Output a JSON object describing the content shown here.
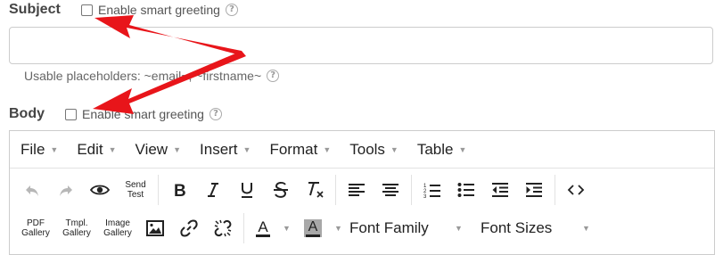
{
  "subject": {
    "label": "Subject",
    "smart_greeting_label": "Enable smart greeting",
    "input_value": "",
    "placeholders_hint": "Usable placeholders: ~email~, ~firstname~"
  },
  "body": {
    "label": "Body",
    "smart_greeting_label": "Enable smart greeting"
  },
  "editor": {
    "menus": [
      {
        "label": "File"
      },
      {
        "label": "Edit"
      },
      {
        "label": "View"
      },
      {
        "label": "Insert"
      },
      {
        "label": "Format"
      },
      {
        "label": "Tools"
      },
      {
        "label": "Table"
      }
    ],
    "toolbar": {
      "send_test_label": "Send Test",
      "pdf_gallery_label": "PDF Gallery",
      "tmpl_gallery_label": "Tmpl. Gallery",
      "image_gallery_label": "Image Gallery",
      "text_color_glyph": "A",
      "bg_color_glyph": "A",
      "font_family_label": "Font Family",
      "font_sizes_label": "Font Sizes"
    },
    "icons": [
      "undo-icon",
      "redo-icon",
      "preview-eye-icon",
      "bold-icon",
      "italic-icon",
      "underline-icon",
      "strikethrough-icon",
      "clear-formatting-icon",
      "align-left-icon",
      "align-center-icon",
      "numbered-list-icon",
      "bullet-list-icon",
      "outdent-icon",
      "indent-icon",
      "source-code-icon",
      "image-icon",
      "link-icon",
      "unlink-icon"
    ]
  },
  "colors": {
    "annotation_arrow": "#e8151a",
    "border": "#cccccc",
    "label": "#444444"
  }
}
